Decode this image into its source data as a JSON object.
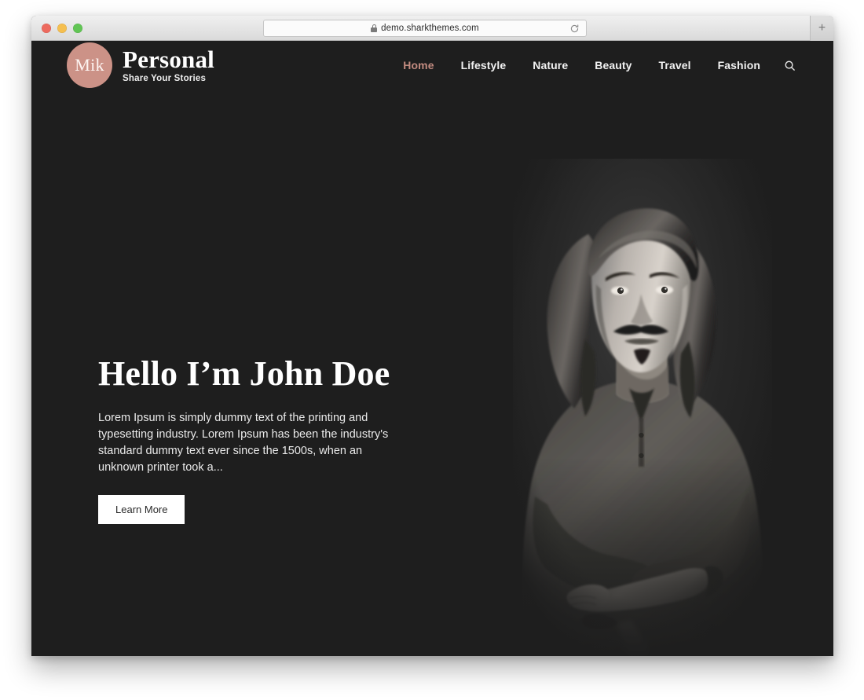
{
  "browser": {
    "url": "demo.sharkthemes.com",
    "lock_icon": "lock-icon",
    "reload_icon": "reload-icon",
    "new_tab_label": "+",
    "traffic_lights": [
      "close-button",
      "minimize-button",
      "zoom-button"
    ]
  },
  "site": {
    "brand": {
      "monogram": "Mik",
      "title": "Personal",
      "tagline": "Share Your Stories",
      "circle_color": "#cc9287"
    },
    "nav": {
      "items": [
        {
          "label": "Home",
          "active": true
        },
        {
          "label": "Lifestyle",
          "active": false
        },
        {
          "label": "Nature",
          "active": false
        },
        {
          "label": "Beauty",
          "active": false
        },
        {
          "label": "Travel",
          "active": false
        },
        {
          "label": "Fashion",
          "active": false
        }
      ],
      "search_icon": "search-icon",
      "active_color": "#c28b80"
    },
    "hero": {
      "title": "Hello I’m John Doe",
      "description": "Lorem Ipsum is simply dummy text of the printing and typesetting industry. Lorem Ipsum has been the industry's standard dummy text ever since the 1500s, when an unknown printer took a...",
      "button_label": "Learn More",
      "background_color": "#1e1e1e",
      "portrait_alt": "Black and white portrait of a man with shoulder-length hair, mustache and soul patch, wearing a dark henley sweater with arms crossed"
    }
  }
}
